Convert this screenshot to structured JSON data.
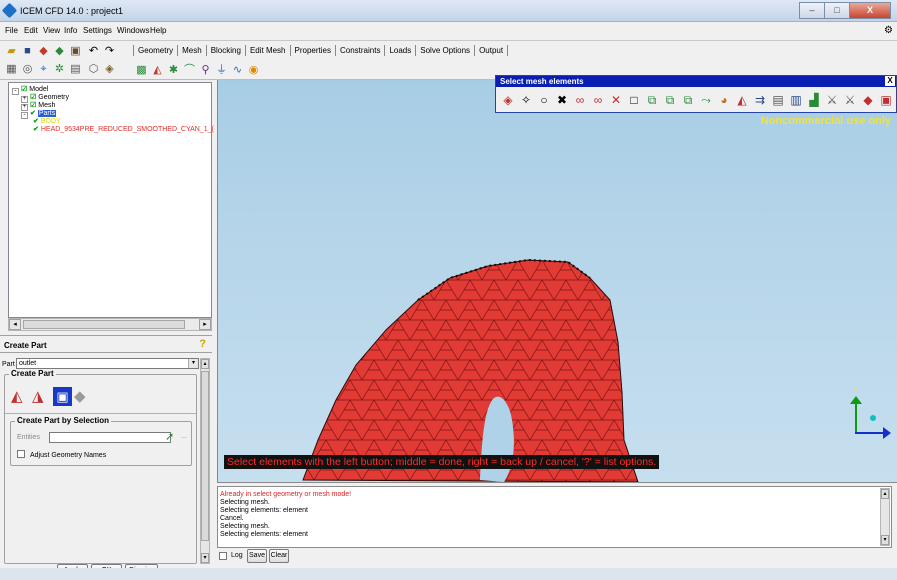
{
  "window": {
    "title": "ICEM CFD 14.0 : project1",
    "buttons": [
      "–",
      "□",
      "X"
    ]
  },
  "menu": [
    "File",
    "Edit",
    "View",
    "Info",
    "Settings",
    "Windows",
    "Help"
  ],
  "tabs": [
    "Geometry",
    "Mesh",
    "Blocking",
    "Edit Mesh",
    "Properties",
    "Constraints",
    "Loads",
    "Solve Options",
    "Output"
  ],
  "tree": {
    "items": [
      {
        "label": "Model",
        "box": "-"
      },
      {
        "label": "Geometry",
        "box": "+"
      },
      {
        "label": "Mesh",
        "box": "+"
      },
      {
        "label": "Parts",
        "box": "-"
      },
      {
        "label": "BODY"
      },
      {
        "label": "HEAD_9534PRE_REDUCED_SMOOTHED_CYAN_1_("
      }
    ]
  },
  "create_part": {
    "title": "Create Part",
    "part_label": "Part",
    "part_value": "outlet",
    "group_title": "Create Part",
    "selection_group_title": "Create Part by Selection",
    "entities_label": "Entities",
    "ellipsis": "...",
    "adjust_label": "Adjust Geometry Names"
  },
  "bottom_buttons": {
    "apply": "Apply",
    "ok": "OK",
    "dismiss": "Dismiss"
  },
  "floating": {
    "title": "Select mesh elements",
    "close": "X"
  },
  "viewport": {
    "watermark": "Noncommercial use only",
    "status": "Select elements with the left button; middle = done, right = back up / cancel, '?' = list options."
  },
  "messages": {
    "lines": [
      "Already in select geometry or mesh mode!",
      "Selecting mesh.",
      "Selecting elements: element",
      "Cancel.",
      "Selecting mesh.",
      "Selecting elements: element"
    ],
    "log_label": "Log",
    "save_label": "Save",
    "clear_label": "Clear"
  },
  "axis": {
    "y": "Y"
  },
  "colors": {
    "mesh_fill": "#e23a34",
    "mesh_edge": "#7a1512",
    "title_bar": "#0a1fb2",
    "status_text": "#ff2a2a",
    "watermark": "#f0e33c"
  }
}
